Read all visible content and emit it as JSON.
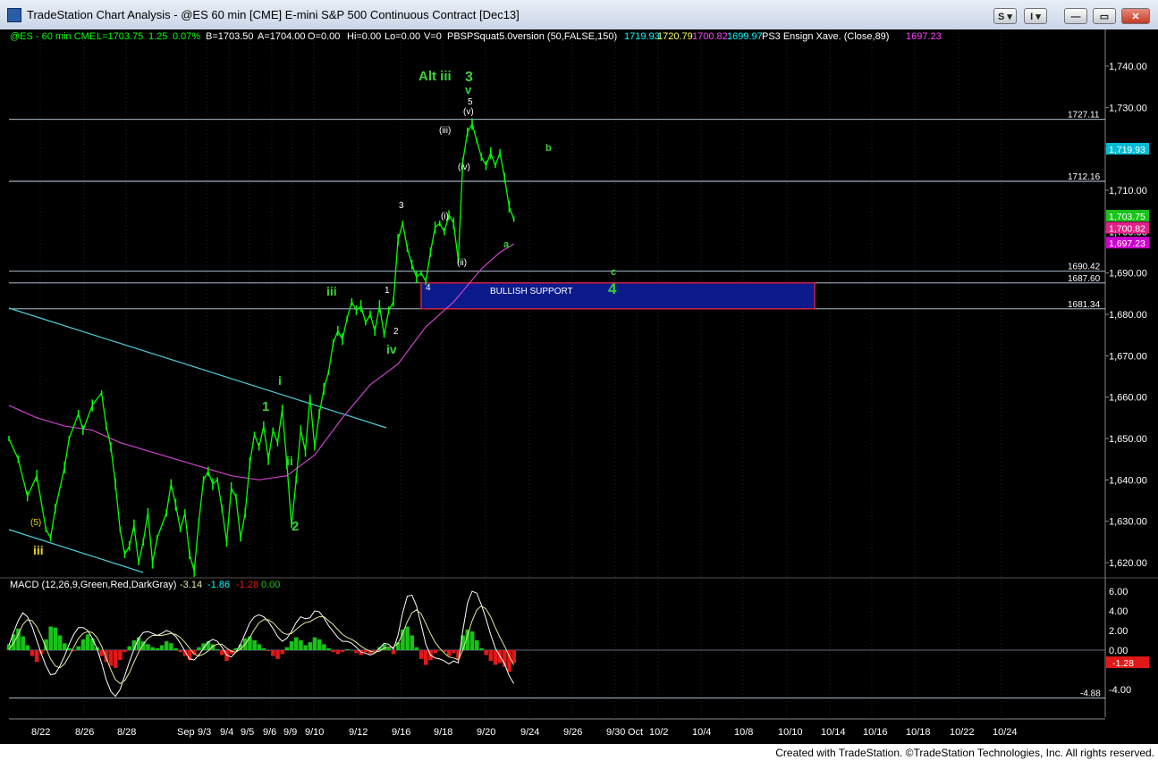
{
  "window": {
    "title": "TradeStation Chart Analysis - @ES 60 min [CME] E-mini S&P 500 Continuous Contract [Dec13]",
    "buttons": {
      "s_menu": "S ▾",
      "i_menu": "I ▾",
      "minimize": "—",
      "maximize": "▭",
      "close": "✕"
    }
  },
  "header": {
    "symbol": "@ES - 60 min  CME",
    "last": "L=1703.75",
    "change": "1.25",
    "pct": "0.07%",
    "bid": "B=1703.50",
    "ask": "A=1704.00",
    "ohl": "O=0.00",
    "hi": "Hi=0.00",
    "lo": "Lo=0.00",
    "vol": "V=0",
    "study": "PBSPSquat5.0version (50,FALSE,150)",
    "study_vals": [
      "1719.93",
      "1720.79",
      "1700.82",
      "1699.97"
    ],
    "ensign": "PS3 Ensign Xave. (Close,89)",
    "ensign_val": "1697.23"
  },
  "colors": {
    "bar": "#00ff00",
    "ma": "#cc44cc",
    "channel": "#4ecdd8",
    "hline": "#c8d8f0",
    "support_fill": "#0b1a8a",
    "support_border": "#cc2244",
    "wave_green": "#3ad13a",
    "wave_yellow": "#e4d21a",
    "macd_hist_pos": "#19c219",
    "macd_hist_neg": "#e01818",
    "signal": "#e8e8a0",
    "macd": "#ffffff"
  },
  "chart_data": {
    "type": "line",
    "title": "@ES - 60 min",
    "price_axis": {
      "ticks": [
        "1,740.00",
        "1,730.00",
        "1,720.00",
        "1,710.00",
        "1,700.00",
        "1,690.00",
        "1,680.00",
        "1,670.00",
        "1,660.00",
        "1,650.00",
        "1,640.00",
        "1,630.00",
        "1,620.00"
      ],
      "range": [
        1617,
        1752
      ]
    },
    "date_axis": [
      "8/22",
      "8/26",
      "8/28",
      "Sep",
      "9/3",
      "9/4",
      "9/5",
      "9/6",
      "9/9",
      "9/10",
      "9/12",
      "9/16",
      "9/18",
      "9/20",
      "9/24",
      "9/26",
      "9/30",
      "Oct",
      "10/2",
      "10/4",
      "10/8",
      "10/10",
      "10/14",
      "10/16",
      "10/18",
      "10/22",
      "10/24"
    ],
    "horizontal_levels": [
      {
        "label": "1727.11",
        "value": 1727.11
      },
      {
        "label": "1712.16",
        "value": 1712.16
      },
      {
        "label": "1690.42",
        "value": 1690.42
      },
      {
        "label": "1687.60",
        "value": 1687.6
      },
      {
        "label": "1681.34",
        "value": 1681.34
      }
    ],
    "price_tags": [
      {
        "label": "1,719.93",
        "value": 1719.93,
        "color": "#00bcd4"
      },
      {
        "label": "1,703.75",
        "value": 1703.75,
        "color": "#19c219"
      },
      {
        "label": "1,700.82",
        "value": 1700.82,
        "color": "#e0218a"
      },
      {
        "label": "1,697.23",
        "value": 1697.23,
        "color": "#cc00cc"
      }
    ],
    "support_zone": {
      "label": "BULLISH SUPPORT",
      "top": 1687.6,
      "bottom": 1681.34
    },
    "price_series": [
      [
        0,
        1650
      ],
      [
        2,
        1645
      ],
      [
        4,
        1636
      ],
      [
        6,
        1641
      ],
      [
        8,
        1628
      ],
      [
        9,
        1626
      ],
      [
        10,
        1633
      ],
      [
        12,
        1643
      ],
      [
        13,
        1650
      ],
      [
        15,
        1656
      ],
      [
        16,
        1652
      ],
      [
        18,
        1658
      ],
      [
        20,
        1661
      ],
      [
        21,
        1653
      ],
      [
        22,
        1648
      ],
      [
        23,
        1639
      ],
      [
        24,
        1628
      ],
      [
        25,
        1622
      ],
      [
        26,
        1624
      ],
      [
        27,
        1629
      ],
      [
        28,
        1620
      ],
      [
        29,
        1625
      ],
      [
        30,
        1632
      ],
      [
        31,
        1620
      ],
      [
        32,
        1626
      ],
      [
        34,
        1632
      ],
      [
        35,
        1639
      ],
      [
        36,
        1634
      ],
      [
        37,
        1628
      ],
      [
        38,
        1632
      ],
      [
        39,
        1622
      ],
      [
        40,
        1618
      ],
      [
        41,
        1630
      ],
      [
        42,
        1640
      ],
      [
        43,
        1642
      ],
      [
        44,
        1639
      ],
      [
        45,
        1640
      ],
      [
        46,
        1633
      ],
      [
        47,
        1625
      ],
      [
        48,
        1638
      ],
      [
        49,
        1636
      ],
      [
        50,
        1626
      ],
      [
        51,
        1632
      ],
      [
        52,
        1644
      ],
      [
        53,
        1651
      ],
      [
        54,
        1648
      ],
      [
        55,
        1653
      ],
      [
        56,
        1645
      ],
      [
        57,
        1652
      ],
      [
        58,
        1649
      ],
      [
        59,
        1657
      ],
      [
        60,
        1644
      ],
      [
        61,
        1629
      ],
      [
        62,
        1640
      ],
      [
        63,
        1652
      ],
      [
        64,
        1647
      ],
      [
        65,
        1660
      ],
      [
        66,
        1648
      ],
      [
        67,
        1656
      ],
      [
        68,
        1662
      ],
      [
        69,
        1666
      ],
      [
        70,
        1673
      ],
      [
        71,
        1676
      ],
      [
        72,
        1674
      ],
      [
        73,
        1679
      ],
      [
        74,
        1683
      ],
      [
        75,
        1681
      ],
      [
        76,
        1682
      ],
      [
        77,
        1678
      ],
      [
        78,
        1680
      ],
      [
        79,
        1676
      ],
      [
        80,
        1682
      ],
      [
        81,
        1675
      ],
      [
        82,
        1681
      ],
      [
        83,
        1683
      ],
      [
        84,
        1698
      ],
      [
        85,
        1702
      ],
      [
        86,
        1696
      ],
      [
        87,
        1692
      ],
      [
        88,
        1689
      ],
      [
        89,
        1690
      ],
      [
        90,
        1688
      ],
      [
        91,
        1695
      ],
      [
        92,
        1701
      ],
      [
        93,
        1702
      ],
      [
        94,
        1700
      ],
      [
        95,
        1704
      ],
      [
        96,
        1702
      ],
      [
        97,
        1693
      ],
      [
        98,
        1717
      ],
      [
        99,
        1724
      ],
      [
        100,
        1726
      ],
      [
        101,
        1722
      ],
      [
        102,
        1718
      ],
      [
        103,
        1716
      ],
      [
        104,
        1719
      ],
      [
        105,
        1716
      ],
      [
        106,
        1719
      ],
      [
        107,
        1713
      ],
      [
        108,
        1706
      ],
      [
        109,
        1703
      ]
    ],
    "ma_series": [
      [
        0,
        1658
      ],
      [
        6,
        1655
      ],
      [
        12,
        1653
      ],
      [
        18,
        1652
      ],
      [
        24,
        1649
      ],
      [
        30,
        1647
      ],
      [
        36,
        1645
      ],
      [
        42,
        1643
      ],
      [
        48,
        1641
      ],
      [
        54,
        1640
      ],
      [
        60,
        1641
      ],
      [
        66,
        1646
      ],
      [
        72,
        1655
      ],
      [
        78,
        1663
      ],
      [
        84,
        1668
      ],
      [
        90,
        1677
      ],
      [
        96,
        1683
      ],
      [
        102,
        1691
      ],
      [
        106,
        1695
      ],
      [
        109,
        1697
      ]
    ],
    "wave_labels": [
      {
        "text": "Alt iii",
        "cls": "g-big"
      },
      {
        "text": "3",
        "cls": "g-big"
      },
      {
        "text": "v",
        "cls": "g-mid"
      },
      {
        "text": "5",
        "cls": "w-small"
      },
      {
        "text": "(v)",
        "cls": "w-small"
      },
      {
        "text": "(iii)",
        "cls": "w-small"
      },
      {
        "text": "(iv)",
        "cls": "w-small"
      },
      {
        "text": "(i)",
        "cls": "w-small"
      },
      {
        "text": "(ii)",
        "cls": "w-small"
      },
      {
        "text": "3",
        "cls": "w-small"
      },
      {
        "text": "4",
        "cls": "w-small"
      },
      {
        "text": "1",
        "cls": "w-small"
      },
      {
        "text": "2",
        "cls": "w-small"
      },
      {
        "text": "iii",
        "cls": "g-mid"
      },
      {
        "text": "iv",
        "cls": "g-mid"
      },
      {
        "text": "i",
        "cls": "g-mid"
      },
      {
        "text": "ii",
        "cls": "g-mid"
      },
      {
        "text": "1",
        "cls": "g-mid"
      },
      {
        "text": "2",
        "cls": "g-mid"
      },
      {
        "text": "(5)",
        "cls": "y-small"
      },
      {
        "text": "iii",
        "cls": "y-mid"
      },
      {
        "text": "b",
        "cls": "g-small"
      },
      {
        "text": "a",
        "cls": "g-small"
      },
      {
        "text": "c",
        "cls": "g-small"
      },
      {
        "text": "4",
        "cls": "g-big"
      }
    ],
    "macd": {
      "legend": "MACD (12,26,9,Green,Red,DarkGray)",
      "values": [
        "-3.14",
        "-1.86",
        "-1.28",
        "0.00"
      ],
      "value_colors": [
        "#e8e8a0",
        "#00ffff",
        "#e01818",
        "#19c219"
      ],
      "axis_ticks": [
        "6.00",
        "4.00",
        "2.00",
        "0.00",
        "-4.00"
      ],
      "current_tag": "-1.28",
      "min_tag": "-4.88",
      "hist": [
        0.6,
        1.6,
        2.2,
        1.4,
        0.5,
        -0.6,
        -1.2,
        -0.4,
        1.1,
        2.4,
        2.3,
        1.5,
        0.7,
        0.2,
        -0.1,
        0.4,
        1.1,
        1.6,
        1.2,
        0.3,
        -0.6,
        -1.2,
        -1.6,
        -1.8,
        -1.0,
        -0.2,
        0.4,
        1.0,
        1.3,
        0.9,
        0.6,
        0.3,
        0.2,
        0.5,
        0.9,
        0.7,
        0.2,
        -0.2,
        -0.6,
        -1.0,
        -0.4,
        0.3,
        0.7,
        0.9,
        0.6,
        0.1,
        -0.5,
        -1.1,
        -0.4,
        0.2,
        0.6,
        1.2,
        1.4,
        1.0,
        0.6,
        0.2,
        -0.1,
        -0.6,
        -0.9,
        -0.4,
        0.3,
        0.9,
        1.3,
        1.0,
        0.5,
        0.8,
        1.3,
        1.1,
        0.6,
        0.2,
        -0.2,
        -0.4,
        -0.2,
        0.1,
        0.0,
        -0.3,
        -0.5,
        -0.2,
        -0.4,
        -0.1,
        0.3,
        0.6,
        0.2,
        -0.4,
        0.8,
        2.1,
        2.4,
        1.5,
        0.3,
        -0.9,
        -1.5,
        -1.0,
        -0.3,
        0.0,
        -0.2,
        -0.6,
        -0.3,
        -0.9,
        1.5,
        2.1,
        1.9,
        1.0,
        0.2,
        -0.5,
        -1.1,
        -1.5,
        -1.3,
        -1.7,
        -2.2,
        -1.3
      ],
      "macd_line": [
        0.5,
        1.8,
        3.0,
        3.8,
        3.4,
        2.4,
        1.0,
        -0.4,
        -1.6,
        -2.5,
        -2.4,
        -1.6,
        -0.6,
        0.6,
        1.6,
        2.3,
        2.3,
        2.0,
        1.2,
        0.2,
        -1.3,
        -3.0,
        -4.2,
        -4.7,
        -4.0,
        -2.6,
        -1.2,
        0.1,
        1.2,
        1.8,
        1.9,
        1.7,
        1.5,
        1.7,
        2.0,
        1.8,
        1.4,
        0.7,
        -0.1,
        -0.9,
        -1.0,
        -0.5,
        0.2,
        0.8,
        1.1,
        0.9,
        0.3,
        -0.5,
        -0.7,
        -0.2,
        0.6,
        1.7,
        2.8,
        3.4,
        3.6,
        3.4,
        2.9,
        2.2,
        1.4,
        0.9,
        1.2,
        1.9,
        2.8,
        3.4,
        3.2,
        3.3,
        4.0,
        3.9,
        3.3,
        2.5,
        1.9,
        1.3,
        0.9,
        0.9,
        0.7,
        0.3,
        -0.2,
        -0.3,
        -0.5,
        -0.3,
        0.2,
        0.7,
        0.6,
        0.1,
        1.5,
        3.8,
        5.5,
        5.6,
        4.5,
        2.6,
        0.6,
        -0.5,
        -0.8,
        -0.9,
        -1.1,
        -1.4,
        -1.1,
        -1.3,
        2.0,
        4.8,
        6.0,
        5.8,
        4.6,
        3.2,
        1.6,
        0.2,
        -0.6,
        -1.4,
        -2.6,
        -3.4
      ],
      "signal_line": [
        0.1,
        0.7,
        1.6,
        2.6,
        3.1,
        3.0,
        2.4,
        1.4,
        0.2,
        -0.9,
        -1.6,
        -1.8,
        -1.4,
        -0.6,
        0.3,
        1.2,
        1.7,
        1.9,
        1.8,
        1.3,
        0.4,
        -0.8,
        -2.0,
        -3.0,
        -3.4,
        -3.1,
        -2.3,
        -1.2,
        -0.2,
        0.6,
        1.2,
        1.5,
        1.5,
        1.5,
        1.6,
        1.7,
        1.6,
        1.3,
        0.8,
        0.2,
        -0.4,
        -0.6,
        -0.4,
        -0.1,
        0.4,
        0.6,
        0.6,
        0.2,
        -0.1,
        -0.2,
        0.1,
        0.6,
        1.3,
        2.1,
        2.8,
        3.1,
        3.1,
        2.8,
        2.3,
        1.8,
        1.6,
        1.7,
        2.1,
        2.5,
        2.8,
        2.9,
        3.2,
        3.4,
        3.4,
        3.0,
        2.6,
        2.1,
        1.6,
        1.3,
        1.1,
        0.8,
        0.4,
        0.1,
        -0.1,
        -0.2,
        -0.1,
        0.2,
        0.3,
        0.3,
        0.7,
        1.7,
        2.9,
        3.8,
        4.1,
        3.7,
        2.7,
        1.7,
        0.8,
        0.2,
        -0.3,
        -0.7,
        -0.8,
        -1.0,
        0.0,
        1.5,
        3.0,
        4.1,
        4.5,
        4.2,
        3.4,
        2.3,
        1.3,
        0.4,
        -0.6,
        -1.5
      ]
    }
  },
  "status": {
    "credit": "Created with TradeStation. ©TradeStation Technologies, Inc. All rights reserved."
  }
}
